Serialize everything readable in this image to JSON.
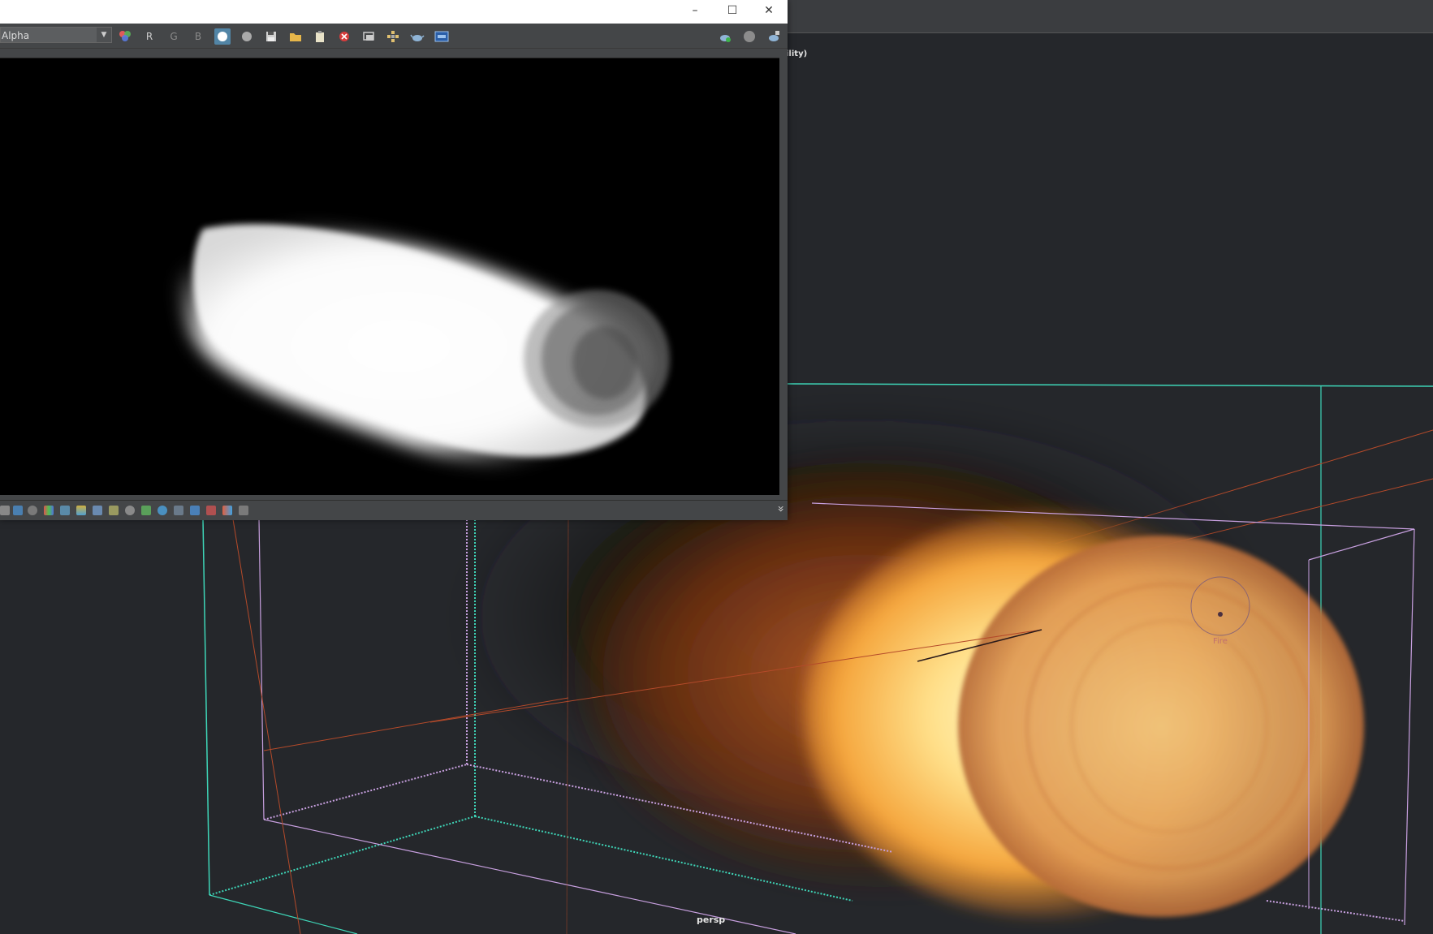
{
  "viewport": {
    "camera_label": "persp",
    "partial_header_text": "ility)",
    "fire_label": "Fire"
  },
  "render_view": {
    "channel": "Alpha",
    "channel_buttons": [
      "R",
      "G",
      "B"
    ],
    "window_controls": {
      "minimize": "–",
      "maximize": "☐",
      "close": "✕"
    },
    "expand_glyph": "»"
  },
  "colors": {
    "viewport_bg": "#25272b",
    "window_bg": "#444648",
    "active_button": "#5285a6",
    "bbox_teal": "#3ed6b8",
    "bbox_pink": "#c8a0e0",
    "axis_red": "#b44a2a"
  }
}
